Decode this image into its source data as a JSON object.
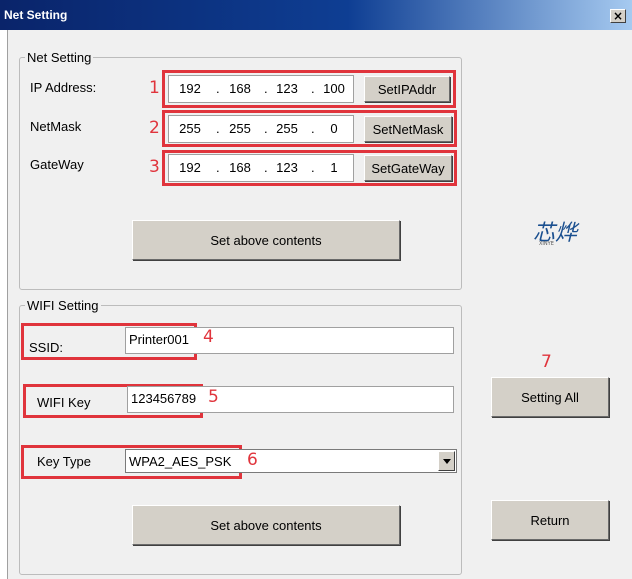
{
  "window": {
    "title": "Net Setting",
    "close_glyph": "×"
  },
  "net_setting": {
    "legend": "Net Setting",
    "ip_address": {
      "label": "IP Address:",
      "octets": [
        "192",
        "168",
        "123",
        "100"
      ],
      "button": "SetIPAddr",
      "marker": "1"
    },
    "netmask": {
      "label": "NetMask",
      "octets": [
        "255",
        "255",
        "255",
        "0"
      ],
      "button": "SetNetMask",
      "marker": "2"
    },
    "gateway": {
      "label": "GateWay",
      "octets": [
        "192",
        "168",
        "123",
        "1"
      ],
      "button": "SetGateWay",
      "marker": "3"
    },
    "apply_button": "Set above contents"
  },
  "logo": {
    "text": "芯烨",
    "subtext": "XINYE"
  },
  "wifi_setting": {
    "legend": "WIFI Setting",
    "ssid": {
      "label": "SSID:",
      "value": "Printer001",
      "marker": "4"
    },
    "wifi_key": {
      "label": "WIFI Key",
      "value": "123456789",
      "marker": "5"
    },
    "key_type": {
      "label": "Key Type",
      "selected": "WPA2_AES_PSK",
      "marker": "6"
    },
    "apply_button": "Set above contents"
  },
  "actions": {
    "setting_all_marker": "7",
    "setting_all": "Setting All",
    "return": "Return"
  },
  "colors": {
    "annotation": "#e0343c",
    "titlebar": "#0a246a"
  }
}
